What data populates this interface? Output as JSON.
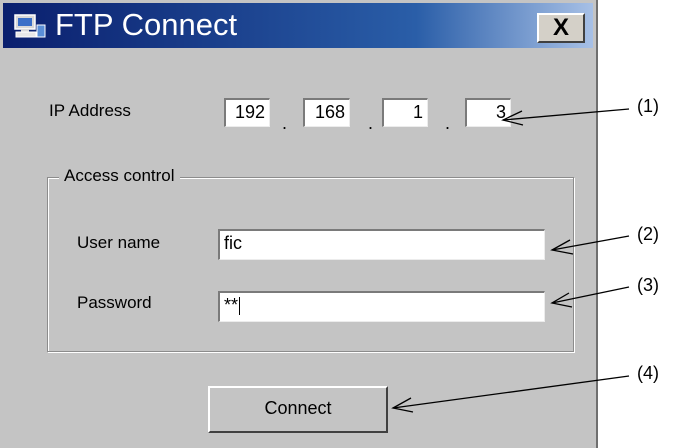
{
  "window": {
    "title": "FTP Connect",
    "close_label": "X",
    "icon": "computer-icon"
  },
  "ip_address": {
    "label": "IP Address",
    "octets": [
      "192",
      "168",
      "1",
      "3"
    ],
    "separator": "."
  },
  "access_control": {
    "group_label": "Access control",
    "username": {
      "label": "User name",
      "value": "fic"
    },
    "password": {
      "label": "Password",
      "value": "**"
    }
  },
  "connect_button": {
    "label": "Connect"
  },
  "callouts": [
    "(1)",
    "(2)",
    "(3)",
    "(4)"
  ],
  "colors": {
    "dialog_bg": "#c4c4c4",
    "titlebar_dark": "#0a1f6e",
    "titlebar_light": "#a7c0e6"
  }
}
